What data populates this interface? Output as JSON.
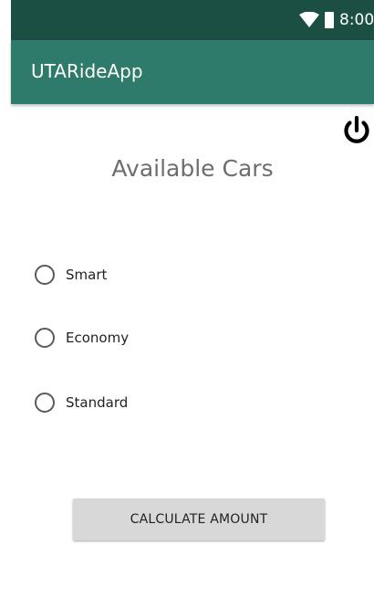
{
  "status_bar": {
    "time": "8:00",
    "wifi_icon": "wifi-icon",
    "battery_icon": "battery-icon"
  },
  "app_bar": {
    "title": "UTARideApp",
    "background": "#2e7a6b"
  },
  "toolbar": {
    "power_icon": "power-icon"
  },
  "main": {
    "title": "Available Cars",
    "options": [
      {
        "label": "Smart",
        "selected": false
      },
      {
        "label": "Economy",
        "selected": false
      },
      {
        "label": "Standard",
        "selected": false
      }
    ],
    "calculate_label": "CALCULATE AMOUNT"
  },
  "colors": {
    "status_bar": "#1c4f43",
    "app_bar": "#2e7a6b",
    "button": "#d8d8d8"
  }
}
